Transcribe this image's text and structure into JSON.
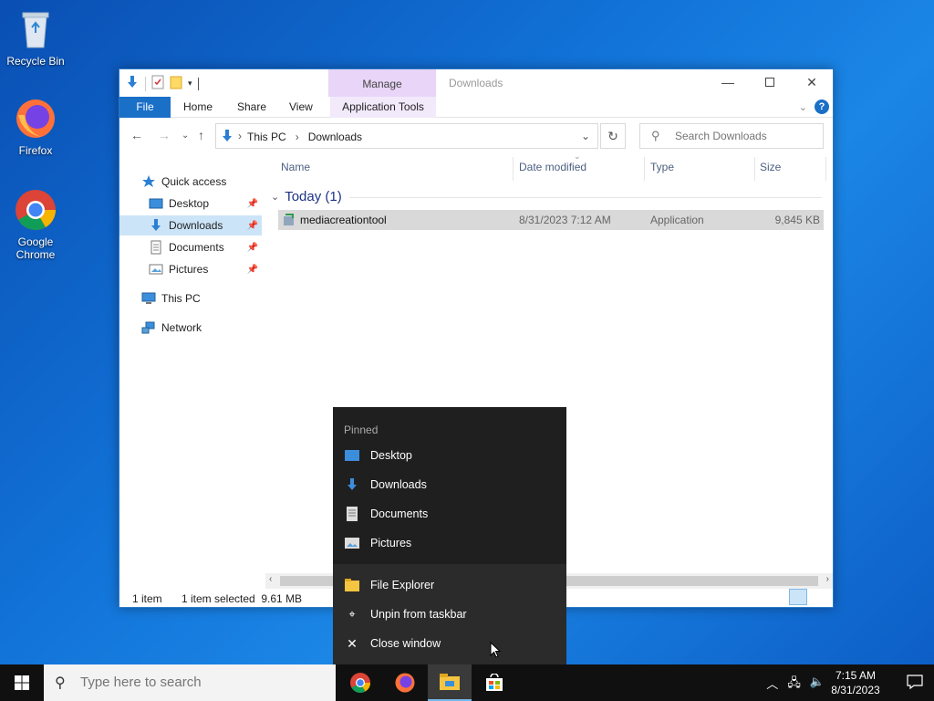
{
  "desktop": {
    "icons": [
      {
        "label": "Recycle Bin"
      },
      {
        "label": "Firefox"
      },
      {
        "label": "Google Chrome"
      }
    ]
  },
  "explorer": {
    "context_tab": "Manage",
    "title": "Downloads",
    "ribbon_tabs": {
      "file": "File",
      "home": "Home",
      "share": "Share",
      "view": "View",
      "app_tools": "Application Tools"
    },
    "breadcrumb": [
      "This PC",
      "Downloads"
    ],
    "search_placeholder": "Search Downloads",
    "nav": {
      "quick_access": "Quick access",
      "desktop": "Desktop",
      "downloads": "Downloads",
      "documents": "Documents",
      "pictures": "Pictures",
      "this_pc": "This PC",
      "network": "Network"
    },
    "columns": {
      "name": "Name",
      "date": "Date modified",
      "type": "Type",
      "size": "Size"
    },
    "group_label": "Today (1)",
    "files": [
      {
        "name": "mediacreationtool",
        "date": "8/31/2023 7:12 AM",
        "type": "Application",
        "size": "9,845 KB"
      }
    ],
    "status": {
      "count": "1 item",
      "selected": "1 item selected  9.61 MB"
    }
  },
  "jumplist": {
    "header": "Pinned",
    "pinned": [
      "Desktop",
      "Downloads",
      "Documents",
      "Pictures"
    ],
    "tasks": [
      "File Explorer",
      "Unpin from taskbar",
      "Close window"
    ]
  },
  "taskbar": {
    "search_placeholder": "Type here to search",
    "time": "7:15 AM",
    "date": "8/31/2023"
  },
  "colors": {
    "accent": "#1a6fc7",
    "manage_tab": "#e8d5f7",
    "selected_row": "#d9d9d9",
    "jumplist_bg": "#1f1f1f"
  }
}
